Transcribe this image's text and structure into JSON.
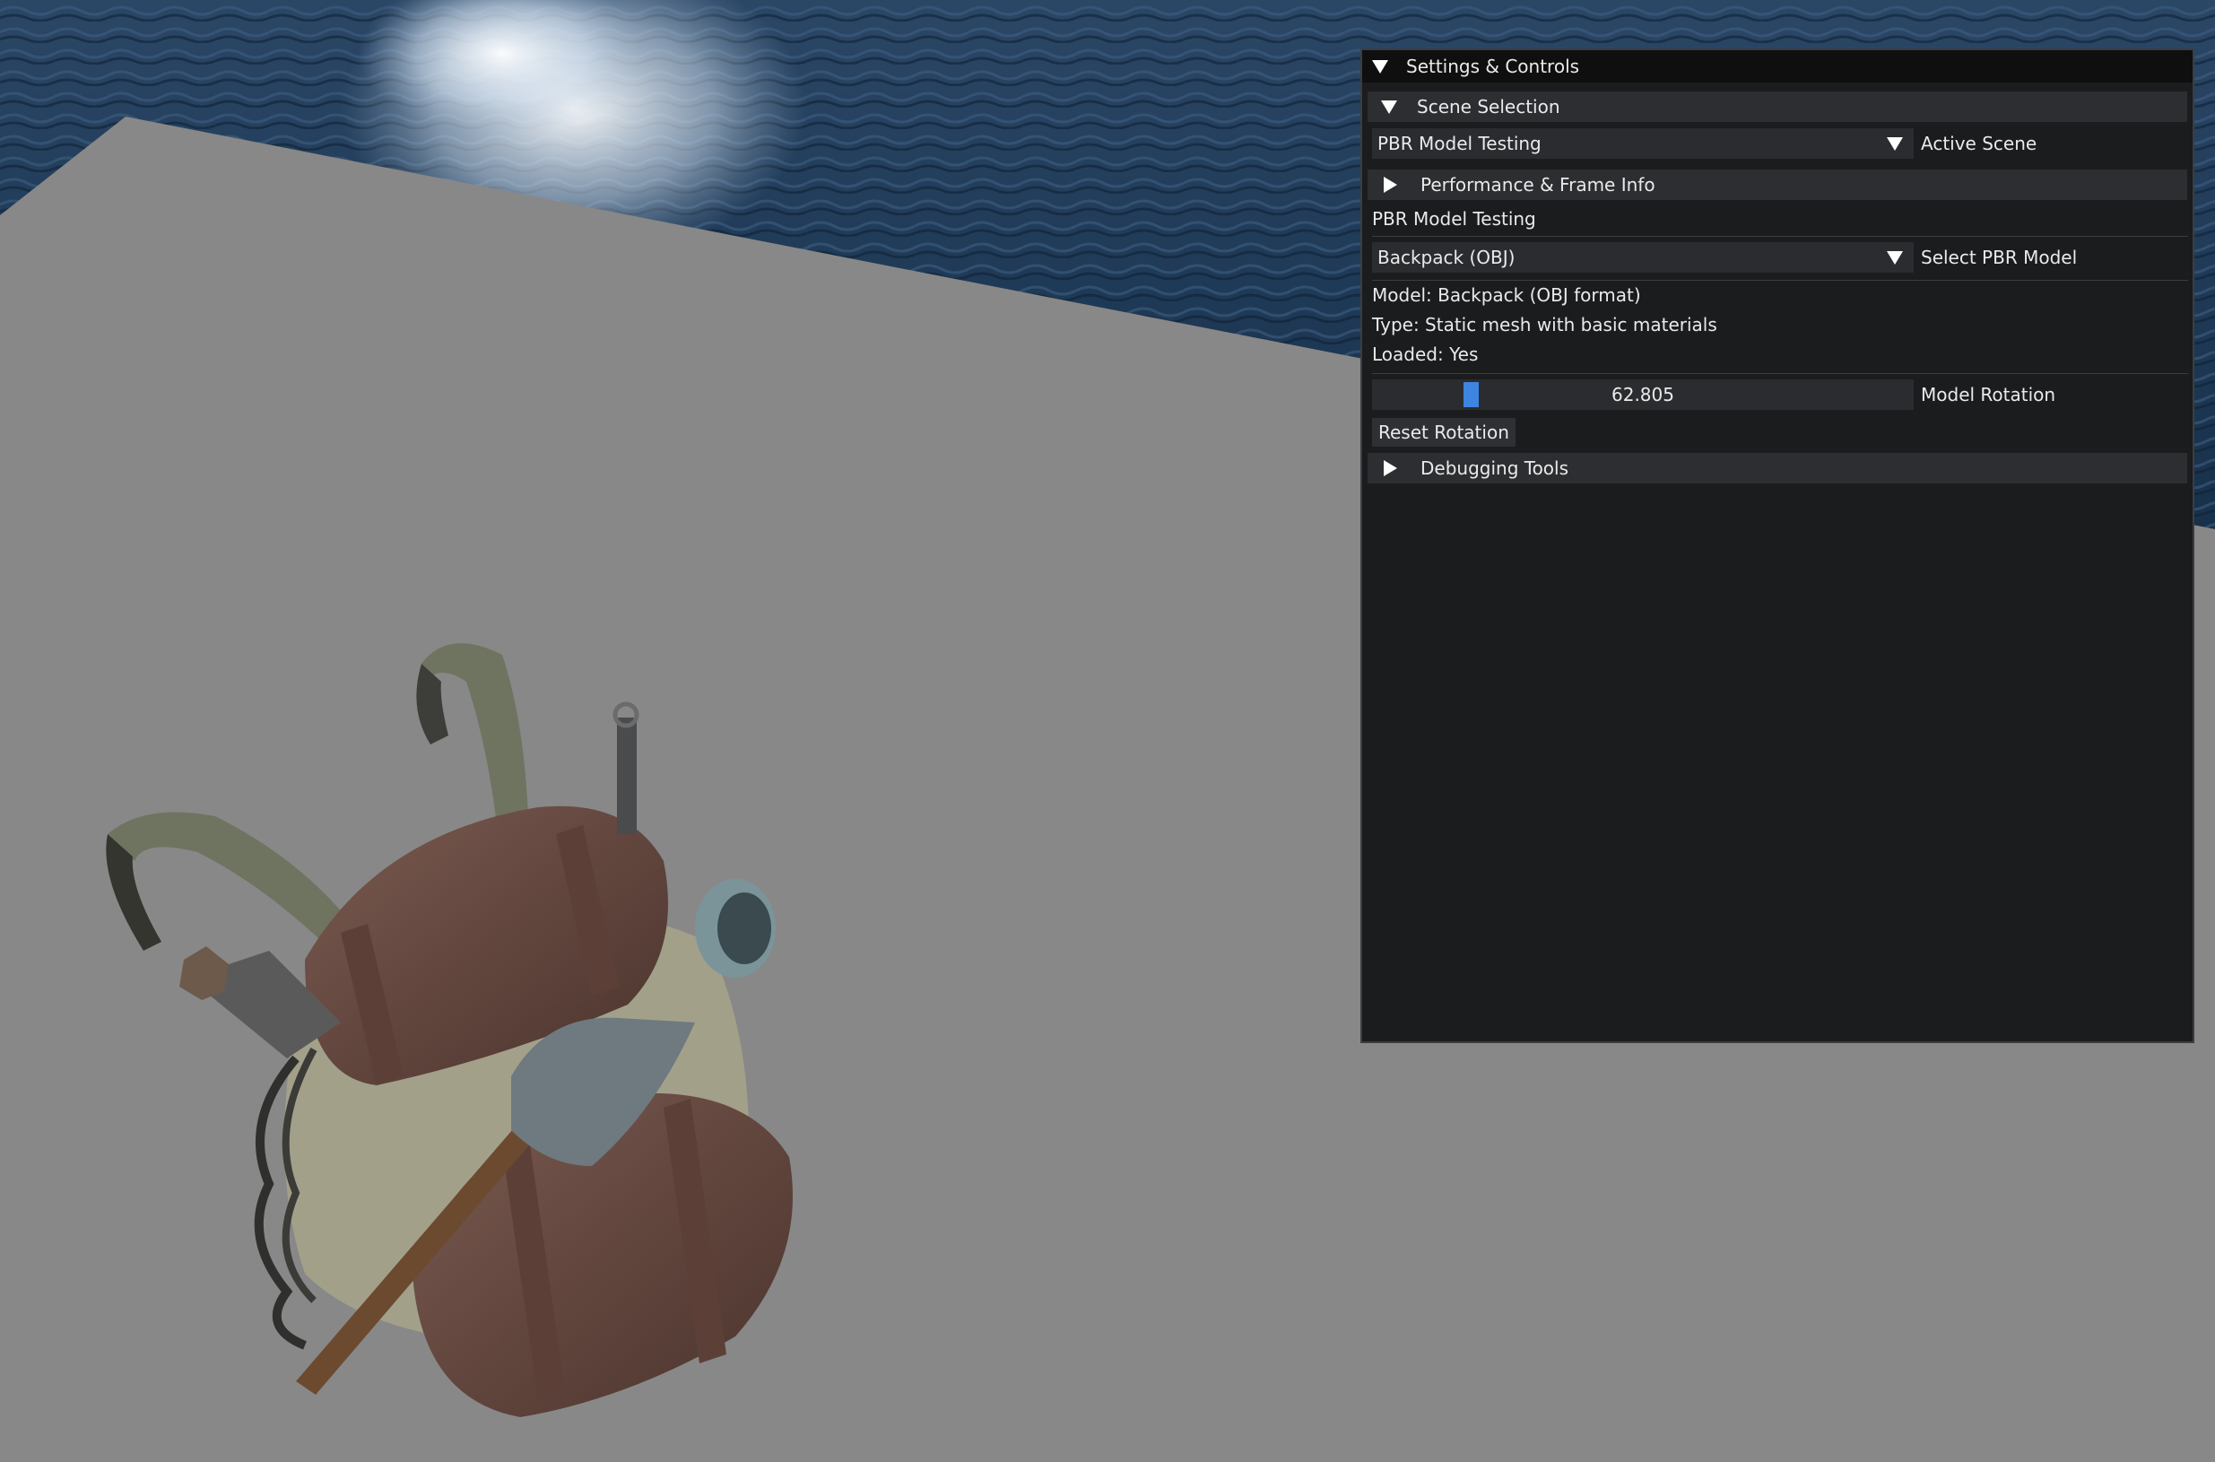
{
  "window": {
    "title": "Settings & Controls"
  },
  "scene_selection": {
    "header": "Scene Selection",
    "active_scene_value": "PBR Model Testing",
    "active_scene_label": "Active Scene"
  },
  "performance": {
    "header": "Performance & Frame Info"
  },
  "pbr_section": {
    "title": "PBR Model Testing",
    "model_select_value": "Backpack (OBJ)",
    "model_select_label": "Select PBR Model",
    "info_model": "Model: Backpack (OBJ format)",
    "info_type": "Type: Static mesh with basic materials",
    "info_loaded": "Loaded: Yes",
    "rotation_value": "62.805",
    "rotation_fraction": 0.174,
    "rotation_label": "Model Rotation",
    "reset_button": "Reset Rotation"
  },
  "debugging": {
    "header": "Debugging Tools"
  },
  "colors": {
    "floor": "#888888",
    "panel_bg": "#1b1c1e",
    "header_bg": "#2d2e31",
    "accent": "#3d85e0"
  }
}
